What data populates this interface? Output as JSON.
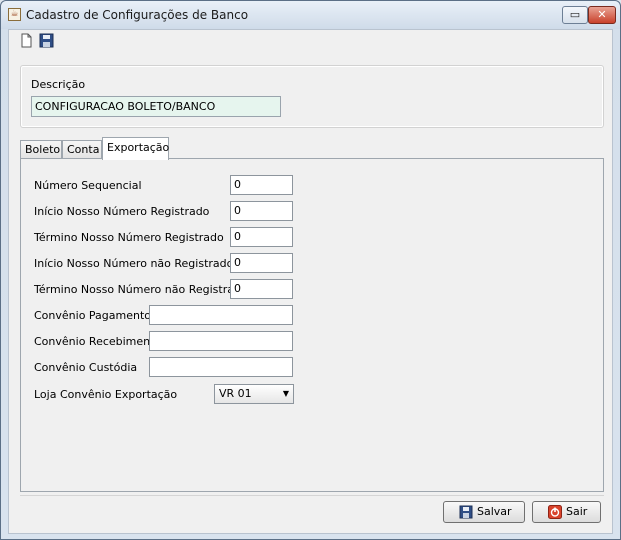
{
  "window": {
    "title": "Cadastro de Configurações de Banco",
    "restore_glyph": "▭",
    "close_glyph": "✕"
  },
  "toolbar": {
    "new_icon": "new-document-icon",
    "save_icon": "save-icon"
  },
  "descricao": {
    "label": "Descrição",
    "value": "CONFIGURACAO BOLETO/BANCO"
  },
  "tabs": [
    {
      "label": "Boleto"
    },
    {
      "label": "Conta"
    },
    {
      "label": "Exportação"
    }
  ],
  "exportacao": {
    "fields": [
      {
        "label": "Número Sequencial",
        "value": "0"
      },
      {
        "label": "Início Nosso Número Registrado",
        "value": "0"
      },
      {
        "label": "Término Nosso Número Registrado",
        "value": "0"
      },
      {
        "label": "Início Nosso Número não Registrado",
        "value": "0"
      },
      {
        "label": "Término Nosso Número não Registrado",
        "value": "0"
      },
      {
        "label": "Convênio Pagamento",
        "value": ""
      },
      {
        "label": "Convênio Recebimento",
        "value": ""
      },
      {
        "label": "Convênio Custódia",
        "value": ""
      }
    ],
    "loja": {
      "label": "Loja Convênio Exportação",
      "selected": "VR 01"
    }
  },
  "buttons": {
    "save_label": "Salvar",
    "exit_label": "Sair"
  },
  "colors": {
    "description_field_bg": "#e6f5ee",
    "close_button": "#c9412b"
  }
}
